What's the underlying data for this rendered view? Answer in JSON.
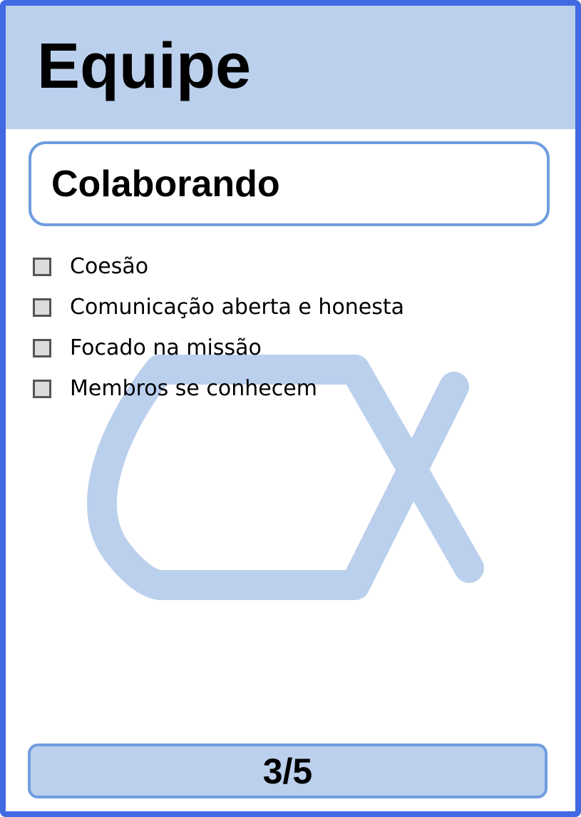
{
  "header": {
    "title": "Equipe"
  },
  "card": {
    "state_title": "Colaborando",
    "checklist": [
      {
        "label": "Coesão",
        "checked": false
      },
      {
        "label": "Comunicação aberta e honesta",
        "checked": false
      },
      {
        "label": "Focado na missão",
        "checked": false
      },
      {
        "label": "Membros se conhecem",
        "checked": false
      }
    ]
  },
  "footer": {
    "page_indicator": "3/5"
  },
  "colors": {
    "border": "#4169e1",
    "header_bg": "#bbd0ed",
    "box_border": "#6f9de0",
    "watermark": "#bbd0ed"
  },
  "watermark": {
    "icon": "cx-logo-watermark"
  }
}
